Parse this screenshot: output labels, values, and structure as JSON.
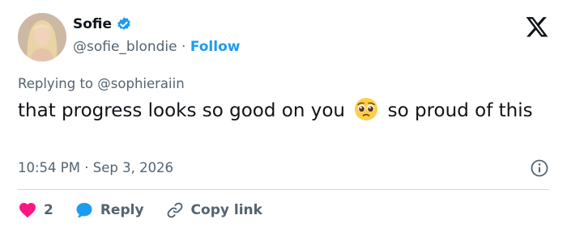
{
  "author": {
    "name": "Sofie",
    "handle": "@sofie_blondie",
    "separator": "·",
    "follow_label": "Follow"
  },
  "reply_context": {
    "prefix": "Replying to",
    "mention": "@sophieraiin"
  },
  "tweet": {
    "text_before_emoji": "that progress looks so good on you",
    "emoji": "pleading-face",
    "text_after_emoji": "so proud of this"
  },
  "meta": {
    "time": "10:54 PM",
    "separator": "·",
    "date": "Sep 3, 2026"
  },
  "actions": {
    "like_count": "2",
    "reply_label": "Reply",
    "copy_label": "Copy link"
  },
  "colors": {
    "accent": "#1d9bf0",
    "like": "#f91880",
    "muted": "#536471",
    "text": "#0f1419"
  }
}
